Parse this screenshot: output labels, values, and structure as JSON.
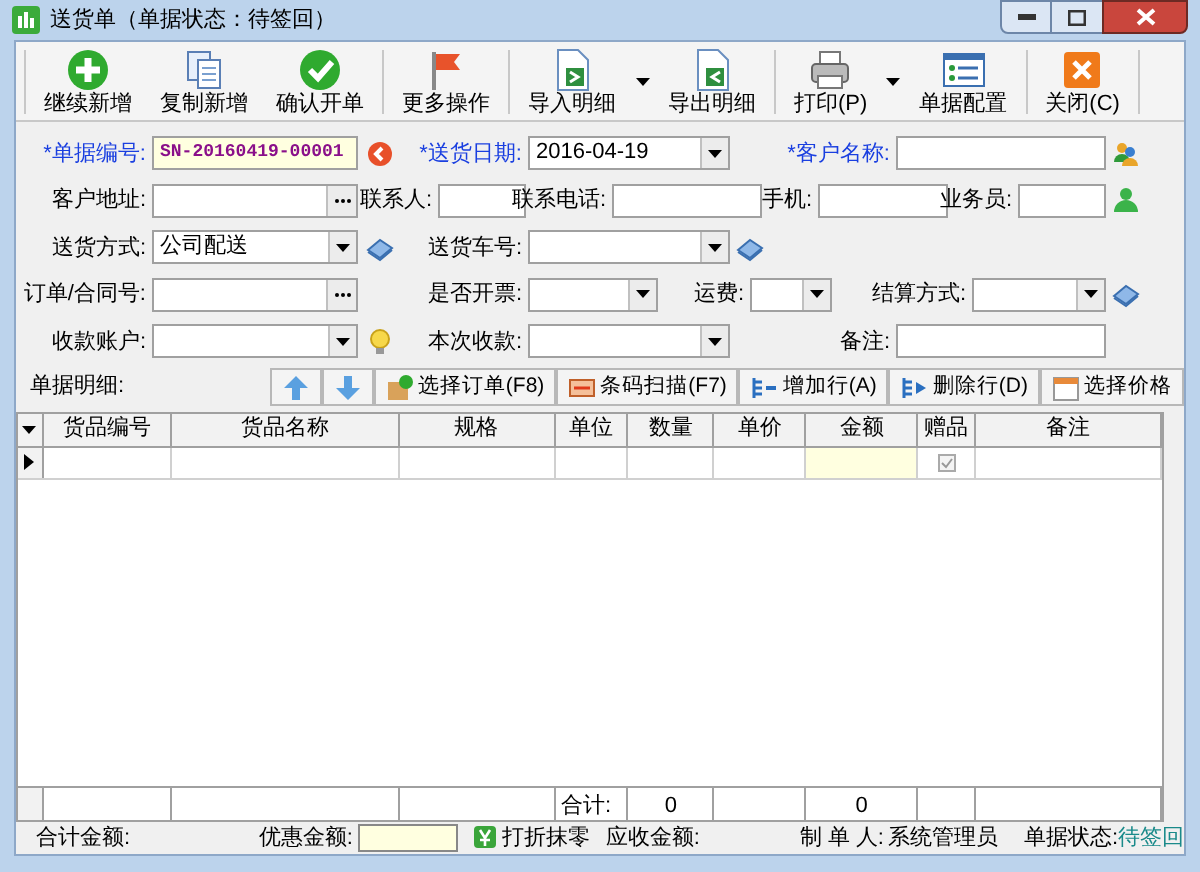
{
  "window": {
    "title": "送货单（单据状态：待签回）"
  },
  "toolbar": {
    "groups": [
      [
        {
          "label": "继续新增"
        },
        {
          "label": "复制新增"
        },
        {
          "label": "确认开单"
        }
      ],
      [
        {
          "label": "更多操作"
        }
      ],
      [
        {
          "label": "导入明细"
        },
        {
          "label": "导出明细"
        }
      ],
      [
        {
          "label": "打印(P)"
        },
        {
          "label": "单据配置"
        }
      ],
      [
        {
          "label": "关闭(C)"
        }
      ]
    ]
  },
  "form": {
    "rows": [
      [
        {
          "label": "*单据编号:",
          "required": true,
          "kind": "number",
          "value": "SN-20160419-00001"
        },
        {
          "label": "*送货日期:",
          "required": true,
          "kind": "dropdown",
          "value": "2016-04-19"
        },
        {
          "label": "*客户名称:",
          "required": true,
          "kind": "text"
        }
      ],
      [
        {
          "label": "客户地址:",
          "required": false,
          "kind": "lookup"
        },
        {
          "label": "联系人:",
          "required": false,
          "kind": "text"
        },
        {
          "label": "联系电话:",
          "required": false,
          "kind": "text"
        },
        {
          "label": "手机:",
          "required": false,
          "kind": "text"
        },
        {
          "label": "业务员:",
          "required": false,
          "kind": "text"
        }
      ],
      [
        {
          "label": "送货方式:",
          "required": false,
          "kind": "dropdown",
          "value": "公司配送"
        },
        {
          "label": "送货车号:",
          "required": false,
          "kind": "dropdown"
        }
      ],
      [
        {
          "label": "订单/合同号:",
          "required": false,
          "kind": "lookup"
        },
        {
          "label": "是否开票:",
          "required": false,
          "kind": "dropdown"
        },
        {
          "label": "运费:",
          "required": false,
          "kind": "dropdown"
        },
        {
          "label": "结算方式:",
          "required": false,
          "kind": "dropdown"
        }
      ],
      [
        {
          "label": "收款账户:",
          "required": false,
          "kind": "dropdown"
        },
        {
          "label": "本次收款:",
          "required": false,
          "kind": "dropdown"
        },
        {
          "label": "备注:",
          "required": false,
          "kind": "text"
        }
      ]
    ]
  },
  "details": {
    "label": "单据明细:",
    "buttons": [
      "选择订单(F8)",
      "条码扫描(F7)",
      "增加行(A)",
      "删除行(D)",
      "选择价格"
    ]
  },
  "table": {
    "columns": [
      "货品编号",
      "货品名称",
      "规格",
      "单位",
      "数量",
      "单价",
      "金额",
      "赠品",
      "备注"
    ],
    "rows": [
      {
        "current": true,
        "gift_checked": true
      }
    ],
    "footer": {
      "total_label": "合计:",
      "quantity": "0",
      "amount": "0"
    }
  },
  "bottom_bar": {
    "total_label": "合计金额:",
    "discount_label": "优惠金额:",
    "round_button": "打折抹零",
    "receivable_label": "应收金额:",
    "maker_label": "制 单 人:",
    "maker": "系统管理员",
    "status_label": "单据状态:",
    "status": "待签回"
  }
}
